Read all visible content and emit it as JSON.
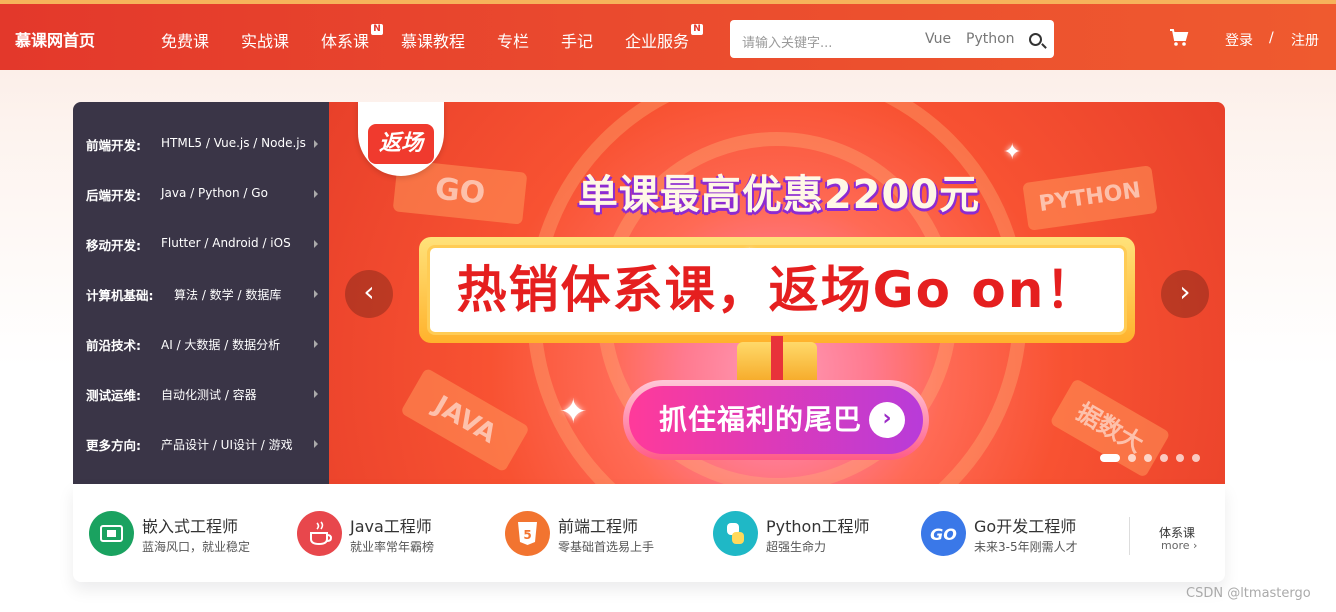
{
  "header": {
    "logo": "慕课网首页",
    "nav": [
      {
        "label": "免费课",
        "badge": ""
      },
      {
        "label": "实战课",
        "badge": ""
      },
      {
        "label": "体系课",
        "badge": "N"
      },
      {
        "label": "慕课教程",
        "badge": ""
      },
      {
        "label": "专栏",
        "badge": ""
      },
      {
        "label": "手记",
        "badge": ""
      },
      {
        "label": "企业服务",
        "badge": "N"
      }
    ],
    "search": {
      "placeholder": "请输入关键字...",
      "hot_words": [
        "Vue",
        "Python"
      ],
      "icon": "search-icon"
    },
    "cart_icon": "cart-icon",
    "login": "登录",
    "separator": "/",
    "register": "注册"
  },
  "menu": [
    {
      "category": "前端开发:",
      "subjects": "HTML5 / Vue.js / Node.js"
    },
    {
      "category": "后端开发:",
      "subjects": "Java / Python / Go"
    },
    {
      "category": "移动开发:",
      "subjects": "Flutter / Android / iOS"
    },
    {
      "category": "计算机基础:",
      "subjects": "算法 / 数学 / 数据库"
    },
    {
      "category": "前沿技术:",
      "subjects": "AI / 大数据 / 数据分析"
    },
    {
      "category": "测试运维:",
      "subjects": "自动化测试 / 容器"
    },
    {
      "category": "更多方向:",
      "subjects": "产品设计 / UI设计 / 游戏"
    }
  ],
  "banner": {
    "badge": "返场",
    "headline": "单课最高优惠2200元",
    "main_text": "热销体系课，返场Go on！",
    "cta": "抓住福利的尾巴",
    "tiles": [
      "GO",
      "PYTHON",
      "JAVA",
      "据数大"
    ],
    "prev": "‹",
    "next": "›",
    "slide_count": 6,
    "active_slide": 1
  },
  "paths": [
    {
      "name": "嵌入式工程师",
      "desc": "蓝海风口，就业稳定",
      "icon": "chip-icon",
      "color": "#1aa260"
    },
    {
      "name": "Java工程师",
      "desc": "就业率常年霸榜",
      "icon": "java-cup-icon",
      "color": "#e8474c"
    },
    {
      "name": "前端工程师",
      "desc": "零基础首选易上手",
      "icon": "html5-icon",
      "color": "#f27430"
    },
    {
      "name": "Python工程师",
      "desc": "超强生命力",
      "icon": "python-icon",
      "color": "#1fb8c6"
    },
    {
      "name": "Go开发工程师",
      "desc": "未来3-5年刚需人才",
      "icon": "go-gopher-icon",
      "color": "#3a78e8"
    }
  ],
  "more": {
    "title": "体系课",
    "link": "more ›"
  },
  "watermark": "CSDN @ltmastergo"
}
